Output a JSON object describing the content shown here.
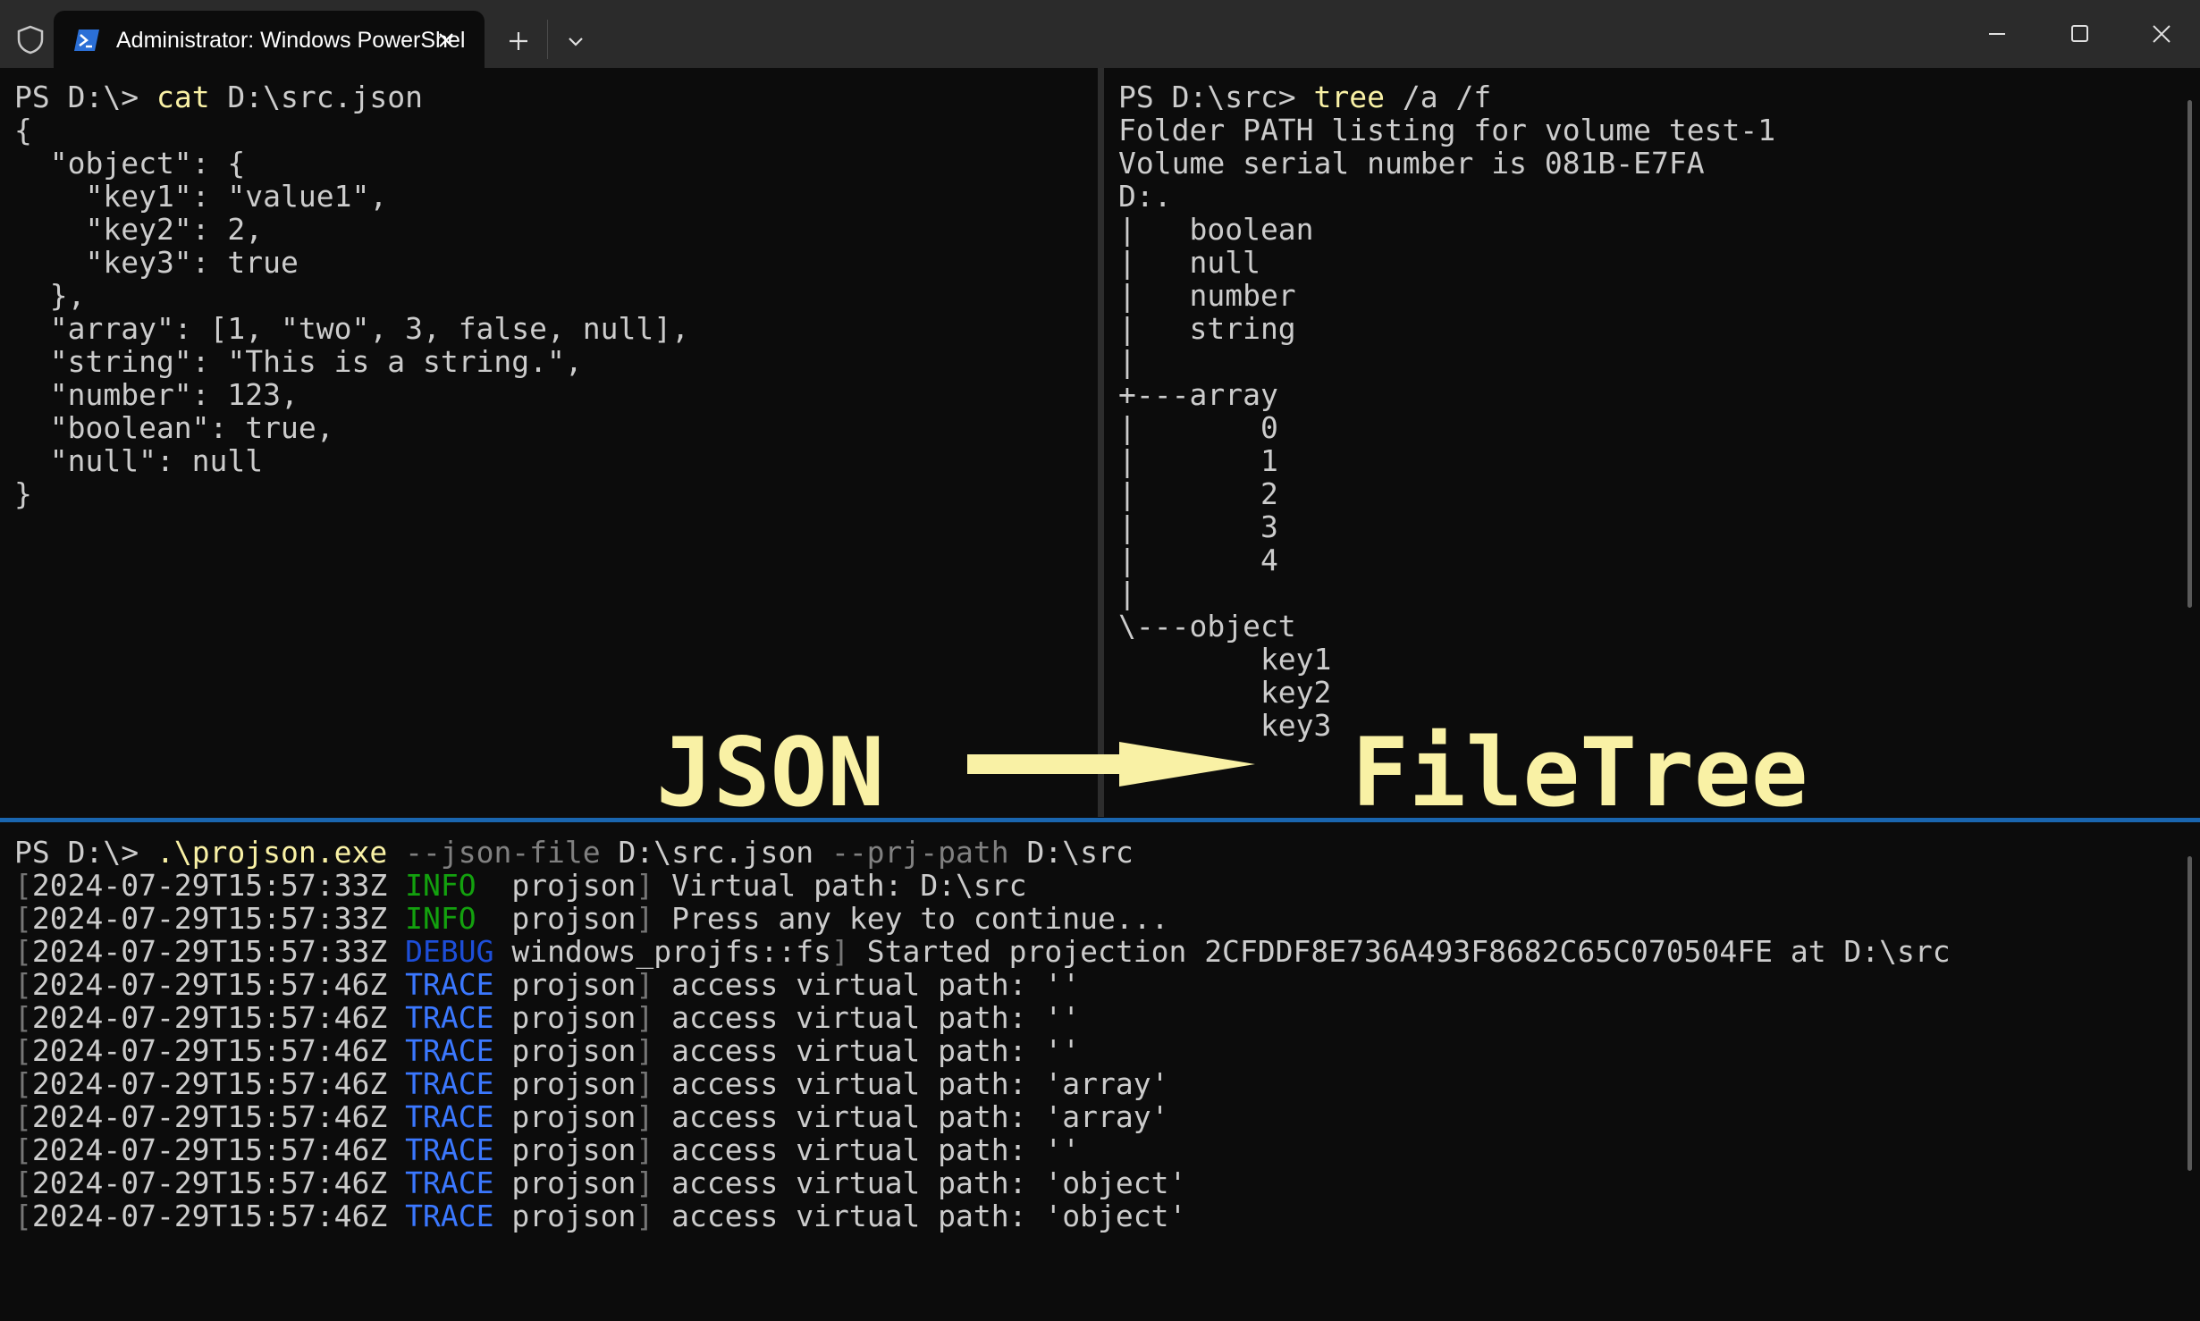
{
  "window": {
    "tab_title": "Administrator: Windows PowerShell",
    "icons": {
      "shield": "shield-icon",
      "tab": "powershell-icon",
      "close_tab": "close-icon",
      "new_tab": "plus-icon",
      "menu": "chevron-down-icon",
      "minimize": "minimize-icon",
      "maximize": "maximize-icon",
      "close": "close-icon"
    }
  },
  "left_pane": {
    "prompt": "PS D:\\> ",
    "command": "cat",
    "argument": " D:\\src.json",
    "output": [
      "{",
      "  \"object\": {",
      "    \"key1\": \"value1\",",
      "    \"key2\": 2,",
      "    \"key3\": true",
      "  },",
      "  \"array\": [1, \"two\", 3, false, null],",
      "  \"string\": \"This is a string.\",",
      "  \"number\": 123,",
      "  \"boolean\": true,",
      "  \"null\": null",
      "}"
    ]
  },
  "right_pane": {
    "prompt": "PS D:\\src> ",
    "command": "tree",
    "argument": " /a /f",
    "output": [
      "Folder PATH listing for volume test-1",
      "Volume serial number is 081B-E7FA",
      "D:.",
      "|   boolean",
      "|   null",
      "|   number",
      "|   string",
      "|",
      "+---array",
      "|       0",
      "|       1",
      "|       2",
      "|       3",
      "|       4",
      "|",
      "\\---object",
      "        key1",
      "        key2",
      "        key3"
    ]
  },
  "bottom_pane": {
    "prompt": "PS D:\\> ",
    "command": ".\\projson.exe",
    "param1": " --json-file",
    "value1": " D:\\src.json",
    "param2": " --prj-path",
    "value2": " D:\\src",
    "log": [
      {
        "ts": "2024-07-29T15:57:33Z",
        "level": "INFO",
        "pad": "  ",
        "target": "projson",
        "msg": "Virtual path: D:\\src"
      },
      {
        "ts": "2024-07-29T15:57:33Z",
        "level": "INFO",
        "pad": "  ",
        "target": "projson",
        "msg": "Press any key to continue..."
      },
      {
        "ts": "2024-07-29T15:57:33Z",
        "level": "DEBUG",
        "pad": " ",
        "target": "windows_projfs::fs",
        "msg": "Started projection 2CFDDF8E736A493F8682C65C070504FE at D:\\src"
      },
      {
        "ts": "2024-07-29T15:57:46Z",
        "level": "TRACE",
        "pad": " ",
        "target": "projson",
        "msg": "access virtual path: ''"
      },
      {
        "ts": "2024-07-29T15:57:46Z",
        "level": "TRACE",
        "pad": " ",
        "target": "projson",
        "msg": "access virtual path: ''"
      },
      {
        "ts": "2024-07-29T15:57:46Z",
        "level": "TRACE",
        "pad": " ",
        "target": "projson",
        "msg": "access virtual path: ''"
      },
      {
        "ts": "2024-07-29T15:57:46Z",
        "level": "TRACE",
        "pad": " ",
        "target": "projson",
        "msg": "access virtual path: 'array'"
      },
      {
        "ts": "2024-07-29T15:57:46Z",
        "level": "TRACE",
        "pad": " ",
        "target": "projson",
        "msg": "access virtual path: 'array'"
      },
      {
        "ts": "2024-07-29T15:57:46Z",
        "level": "TRACE",
        "pad": " ",
        "target": "projson",
        "msg": "access virtual path: ''"
      },
      {
        "ts": "2024-07-29T15:57:46Z",
        "level": "TRACE",
        "pad": " ",
        "target": "projson",
        "msg": "access virtual path: 'object'"
      },
      {
        "ts": "2024-07-29T15:57:46Z",
        "level": "TRACE",
        "pad": " ",
        "target": "projson",
        "msg": "access virtual path: 'object'"
      }
    ]
  },
  "overlay": {
    "left_label": "JSON",
    "right_label": "FileTree",
    "color": "#f9f1a5"
  },
  "colors": {
    "background": "#0c0c0c",
    "text": "#cccccc",
    "command": "#f9f1a5",
    "info": "#13a10e",
    "debug": "#1d4ed8",
    "trace": "#3b78ff",
    "focus_divider": "#1a66b0"
  }
}
